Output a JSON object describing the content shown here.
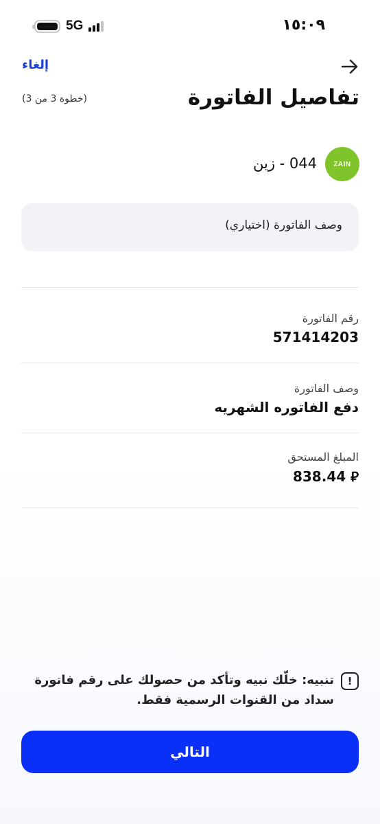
{
  "status_bar": {
    "network": "5G",
    "time": "١٥:٠٩"
  },
  "header": {
    "cancel_label": "إلغاء",
    "back_icon": "arrow-right-icon",
    "title": "تفاصيل الفاتورة",
    "step": "(خطوة 3 من 3)"
  },
  "provider": {
    "logo_text": "ZAIN",
    "logo_color": "#7fc42a",
    "name": "044 - زين"
  },
  "description_field": {
    "placeholder": "وصف الفاتورة (اختياري)",
    "value": ""
  },
  "details": [
    {
      "label": "رقم الفاتورة",
      "value": "571414203"
    },
    {
      "label": "وصف الفاتورة",
      "value": "دفع الفاتوره الشهريه"
    },
    {
      "label": "المبلغ المستحق",
      "value": "838.44 ⃁"
    }
  ],
  "notice": {
    "icon": "exclamation-icon",
    "text": "تنبيه: خلّك نبيه وتأكد من حصولك على رقم فاتورة سداد من القنوات الرسمية فقط."
  },
  "next_button": {
    "label": "التالي",
    "color": "#0a2ff7"
  }
}
